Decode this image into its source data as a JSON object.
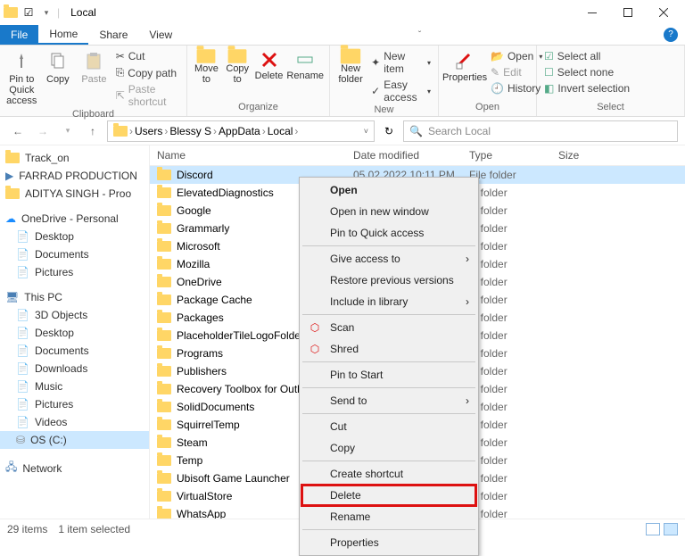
{
  "title": "Local",
  "tabs": {
    "file": "File",
    "home": "Home",
    "share": "Share",
    "view": "View"
  },
  "ribbon": {
    "clipboard": {
      "label": "Clipboard",
      "pin": "Pin to Quick access",
      "copy": "Copy",
      "paste": "Paste",
      "cut": "Cut",
      "copypath": "Copy path",
      "pasteshortcut": "Paste shortcut"
    },
    "organize": {
      "label": "Organize",
      "moveto": "Move to",
      "copyto": "Copy to",
      "delete": "Delete",
      "rename": "Rename"
    },
    "new": {
      "label": "New",
      "newfolder": "New folder",
      "newitem": "New item",
      "easyaccess": "Easy access"
    },
    "open": {
      "label": "Open",
      "properties": "Properties",
      "open": "Open",
      "edit": "Edit",
      "history": "History"
    },
    "select": {
      "label": "Select",
      "selectall": "Select all",
      "selectnone": "Select none",
      "invert": "Invert selection"
    }
  },
  "breadcrumb": [
    "Users",
    "Blessy S",
    "AppData",
    "Local"
  ],
  "search_placeholder": "Search Local",
  "sidebar": {
    "quick": [
      {
        "label": "Track_on",
        "icon": "folder"
      },
      {
        "label": "FARRAD PRODUCTION",
        "icon": "video"
      },
      {
        "label": "ADITYA SINGH - Proo",
        "icon": "folder"
      }
    ],
    "onedrive": {
      "label": "OneDrive - Personal",
      "items": [
        "Desktop",
        "Documents",
        "Pictures"
      ]
    },
    "thispc": {
      "label": "This PC",
      "items": [
        "3D Objects",
        "Desktop",
        "Documents",
        "Downloads",
        "Music",
        "Pictures",
        "Videos",
        "OS (C:)"
      ]
    },
    "network": "Network"
  },
  "columns": {
    "name": "Name",
    "date": "Date modified",
    "type": "Type",
    "size": "Size"
  },
  "files": [
    {
      "name": "Discord",
      "date": "05 02 2022 10:11 PM",
      "type": "File folder",
      "sel": true
    },
    {
      "name": "ElevatedDiagnostics",
      "type": "le folder"
    },
    {
      "name": "Google",
      "type": "le folder"
    },
    {
      "name": "Grammarly",
      "type": "le folder"
    },
    {
      "name": "Microsoft",
      "type": "le folder"
    },
    {
      "name": "Mozilla",
      "type": "le folder"
    },
    {
      "name": "OneDrive",
      "type": "le folder"
    },
    {
      "name": "Package Cache",
      "type": "le folder"
    },
    {
      "name": "Packages",
      "type": "le folder"
    },
    {
      "name": "PlaceholderTileLogoFolder",
      "type": "le folder"
    },
    {
      "name": "Programs",
      "type": "le folder"
    },
    {
      "name": "Publishers",
      "type": "le folder"
    },
    {
      "name": "Recovery Toolbox for Outlook",
      "type": "le folder"
    },
    {
      "name": "SolidDocuments",
      "type": "le folder"
    },
    {
      "name": "SquirrelTemp",
      "type": "le folder"
    },
    {
      "name": "Steam",
      "type": "le folder"
    },
    {
      "name": "Temp",
      "type": "le folder"
    },
    {
      "name": "Ubisoft Game Launcher",
      "type": "le folder"
    },
    {
      "name": "VirtualStore",
      "type": "le folder"
    },
    {
      "name": "WhatsApp",
      "type": "le folder"
    }
  ],
  "context": {
    "open": "Open",
    "newwindow": "Open in new window",
    "pinquick": "Pin to Quick access",
    "giveaccess": "Give access to",
    "restore": "Restore previous versions",
    "include": "Include in library",
    "scan": "Scan",
    "shred": "Shred",
    "pinstart": "Pin to Start",
    "sendto": "Send to",
    "cut": "Cut",
    "copy": "Copy",
    "shortcut": "Create shortcut",
    "delete": "Delete",
    "rename": "Rename",
    "properties": "Properties"
  },
  "status": {
    "items": "29 items",
    "selected": "1 item selected"
  }
}
